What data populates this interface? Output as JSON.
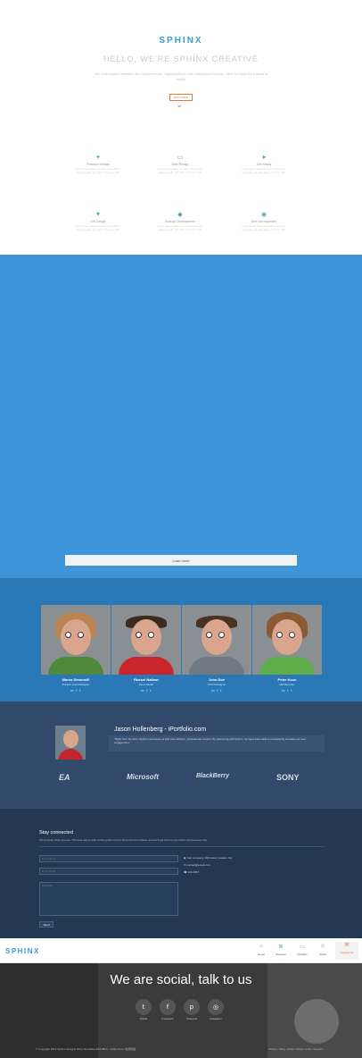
{
  "hero": {
    "brand": "SPHINX",
    "headline": "HELLO, WE'RE SPHINX CREATIVE",
    "subtitle": "We chat superb websites for entrepreneurs, organizations and established brands. Here to make their ideas a reality.",
    "cta": "DISCOVER",
    "features": [
      {
        "icon": "bulb-icon",
        "glyph": "✦",
        "title": "Premium Design",
        "desc": "Lorem ipsum dolor sit amet, consectetur adipiscing elit, sed diam nonummy nibh."
      },
      {
        "icon": "monitor-icon",
        "glyph": "▭",
        "title": "Web Design",
        "desc": "Lorem ipsum dolor sit amet, consectetur adipiscing elit, sed diam nonummy nibh."
      },
      {
        "icon": "paper-plane-icon",
        "glyph": "➤",
        "title": "Get Ready",
        "desc": "Lorem ipsum dolor sit amet, consectetur adipiscing elit, sed diam nonummy nibh."
      },
      {
        "icon": "apple-icon",
        "glyph": "●",
        "title": "iOS Design",
        "desc": "Lorem ipsum dolor sit amet, consectetur adipiscing elit, sed diam nonummy nibh."
      },
      {
        "icon": "android-icon",
        "glyph": "◆",
        "title": "Android Development",
        "desc": "Lorem ipsum dolor sit amet, consectetur adipiscing elit, sed diam nonummy nibh."
      },
      {
        "icon": "eye-icon",
        "glyph": "◉",
        "title": "Web Development",
        "desc": "Lorem ipsum dolor sit amet, consectetur adipiscing elit, sed diam nonummy nibh."
      }
    ]
  },
  "portfolio": {
    "load_more": "Load more"
  },
  "team": {
    "members": [
      {
        "name": "Marco Simonelli",
        "role": "Product Lead Designer",
        "social": "in f t"
      },
      {
        "name": "Russel Nathan",
        "role": "Front Studio",
        "social": "in f t"
      },
      {
        "name": "John Doe",
        "role": "UX/UI Designer",
        "social": "in f t"
      },
      {
        "name": "Peter Kuzu",
        "role": "HR Recruiter",
        "social": "in f t"
      }
    ]
  },
  "testimonial": {
    "name": "Jason Hollenberg - iPortfolio.com",
    "quote": "\"Right from the start, Sphinx impressed us with their efficient, professional manner. By partnering with Sphinx, we have been able to consistently increase our user engagement.\""
  },
  "clients": [
    "EA",
    "Microsoft",
    "BlackBerry",
    "SONY"
  ],
  "contact": {
    "title": "Stay connected",
    "subtitle": "We're ready when you are. The best way to start working with us is to fill out the form below, and we'll get back to you within one business day.",
    "name_placeholder": "Enter Name",
    "email_placeholder": "Enter Email",
    "message_placeholder": "Message",
    "send": "Send",
    "address": "Your company, 000 street, location city",
    "email": "contact@email.com",
    "phone": "123-4567"
  },
  "nav": {
    "brand": "SPHINX",
    "items": [
      {
        "label": "Home",
        "glyph": "⌂"
      },
      {
        "label": "Services",
        "glyph": "≣"
      },
      {
        "label": "Portfolio",
        "glyph": "▭"
      },
      {
        "label": "About",
        "glyph": "☺"
      },
      {
        "label": "Contact Us",
        "glyph": "✉"
      }
    ]
  },
  "social": {
    "title": "We are social, talk to us",
    "buttons": [
      {
        "label": "Twitter",
        "glyph": "t"
      },
      {
        "label": "Facebook",
        "glyph": "f"
      },
      {
        "label": "Pinterest",
        "glyph": "p"
      },
      {
        "label": "Instagram",
        "glyph": "◎"
      }
    ],
    "copyright": "© Copyright 2013 Sphinx Designs More Templates DGUIBOI - Collect from 免费模板",
    "footer_links": "Privacy / Blog / About / Press / Jobs / Support"
  },
  "colors": {
    "brand": "#3a9ccf",
    "accent": "#e27a3f",
    "portfolio_bg": "#3d94d9",
    "team_bg": "#2b78b7",
    "testimonial_bg": "#31496a",
    "contact_bg": "#223951"
  }
}
